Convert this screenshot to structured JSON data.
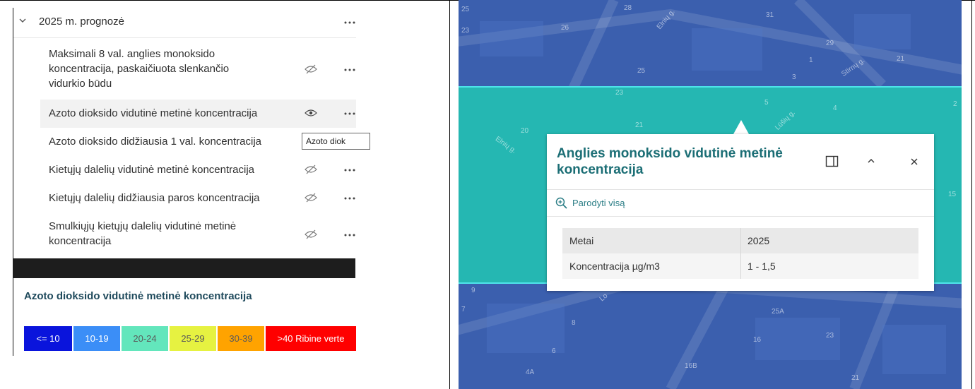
{
  "panel": {
    "group": {
      "label": "2025 m. prognozė",
      "expanded": true
    },
    "layers": [
      {
        "label": "Maksimali 8 val. anglies monoksido koncentracija, paskaičiuota slenkančio vidurkio būdu",
        "visible": false
      },
      {
        "label": "Azoto dioksido vidutinė metinė koncentracija",
        "visible": true
      },
      {
        "label": "Azoto dioksido didžiausia 1 val. koncentracija",
        "visible": false
      },
      {
        "label": "Kietųjų dalelių vidutinė metinė koncentracija",
        "visible": false
      },
      {
        "label": "Kietųjų dalelių didžiausia paros koncentracija",
        "visible": false
      },
      {
        "label": "Smulkiųjų kietųjų dalelių vidutinė metinė koncentracija",
        "visible": false
      }
    ],
    "tooltip": "Azoto diok"
  },
  "legend": {
    "title": "Azoto dioksido vidutinė metinė koncentracija",
    "items": [
      {
        "label": "<= 10",
        "color": "#0a14dc"
      },
      {
        "label": "10-19",
        "color": "#3b8ef7"
      },
      {
        "label": "20-24",
        "color": "#63e6bc"
      },
      {
        "label": "25-29",
        "color": "#e6f241"
      },
      {
        "label": "30-39",
        "color": "#ffa300"
      },
      {
        "label": ">40 Ribine verte",
        "color": "#ff0000"
      }
    ]
  },
  "map": {
    "numbers": [
      "25",
      "23",
      "26",
      "28",
      "31",
      "29",
      "21",
      "1",
      "3",
      "25",
      "23",
      "5",
      "2",
      "4",
      "20",
      "21",
      "15",
      "9",
      "7",
      "25A",
      "8",
      "16",
      "23",
      "6",
      "4A",
      "16B",
      "21"
    ],
    "streets": [
      "Elnių g.",
      "Stirnų g.",
      "Elnių g.",
      "Lūšių g.",
      "Lo"
    ]
  },
  "popup": {
    "title": "Anglies monoksido vidutinė metinė koncentracija",
    "zoom_label": "Parodyti visą",
    "rows": [
      {
        "key": "Metai",
        "value": "2025"
      },
      {
        "key": "Koncentracija µg/m3",
        "value": "1 - 1,5"
      }
    ]
  }
}
